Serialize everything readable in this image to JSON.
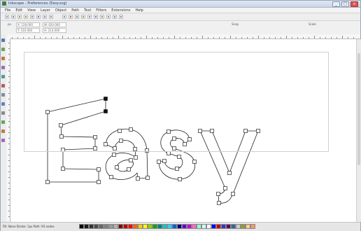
{
  "window": {
    "title": "Inkscape - Preferences (Easy.svg)",
    "buttons": [
      "_",
      "□",
      "×"
    ]
  },
  "menubar": {
    "items": [
      "File",
      "Edit",
      "View",
      "Layer",
      "Object",
      "Path",
      "Text",
      "Filters",
      "Extensions",
      "Help"
    ]
  },
  "commands": {
    "tool_colors": [
      "#7b8ea8",
      "#5c86c5",
      "#6aa35a",
      "#c07b3a",
      "#8a8a8a",
      "#5a78b0",
      "#9a6db5",
      "#4f9c9b",
      "#7a8fa8",
      "#c25656",
      "#5c86c5",
      "#6aa35a",
      "#8a8a8a",
      "#5a78b0",
      "#c07b3a",
      "#7b8ea8",
      "#4f9c9b",
      "#9a6db5"
    ]
  },
  "controls": {
    "field_x": "X: 128.000",
    "field_y": "Y: 310.000",
    "field_w": "W: 620.000",
    "field_h": "H: 214.000",
    "label_units": "px",
    "label_snap": "Snap",
    "label_scale": "Scale"
  },
  "toolbox": {
    "tool_colors": [
      "#5a78b0",
      "#6aa35a",
      "#c07b3a",
      "#9a6db5",
      "#4f9c9b",
      "#c25656",
      "#7b8ea8",
      "#5c86c5",
      "#8a8a8a",
      "#6aa35a",
      "#c07b3a",
      "#9a6db5"
    ]
  },
  "canvas": {
    "text": "Easy",
    "stroke_color": "#222222",
    "node_fill": "#ffffff"
  },
  "status": {
    "text": "Fill: None   Stroke: 1px   Path: 93 nodes"
  },
  "palette": {
    "colors": [
      "#000000",
      "#1a1a1a",
      "#333333",
      "#4d4d4d",
      "#666666",
      "#808080",
      "#999999",
      "#b3b3b3",
      "#800000",
      "#c00000",
      "#ff0000",
      "#ff6600",
      "#ffcc00",
      "#ffff00",
      "#99cc00",
      "#00aa00",
      "#008080",
      "#00cccc",
      "#33ccff",
      "#0066cc",
      "#000080",
      "#6600cc",
      "#cc00cc",
      "#ff66cc",
      "#99ffcc",
      "#ccffff",
      "#ffffff",
      "#0000ff",
      "#cc0000",
      "#3333cc",
      "#660066",
      "#336699",
      "#cccccc",
      "#999933",
      "#ffcc99",
      "#ff9966"
    ]
  }
}
